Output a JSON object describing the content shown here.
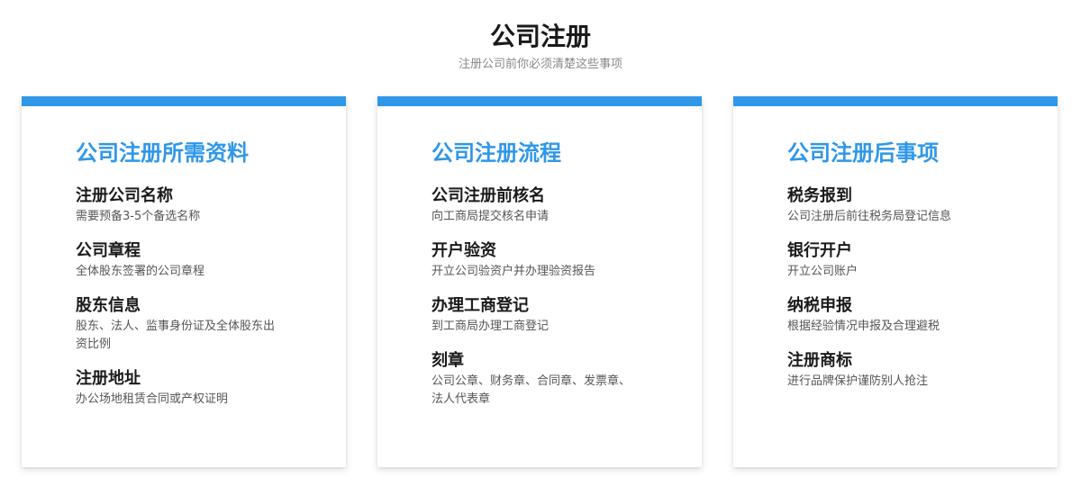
{
  "header": {
    "title": "公司注册",
    "subtitle": "注册公司前你必须清楚这些事项"
  },
  "cards": [
    {
      "title": "公司注册所需资料",
      "items": [
        {
          "title": "注册公司名称",
          "desc": "需要预备3-5个备选名称"
        },
        {
          "title": "公司章程",
          "desc": "全体股东签署的公司章程"
        },
        {
          "title": "股东信息",
          "desc": "股东、法人、监事身份证及全体股东出资比例"
        },
        {
          "title": "注册地址",
          "desc": "办公场地租赁合同或产权证明"
        }
      ]
    },
    {
      "title": "公司注册流程",
      "items": [
        {
          "title": "公司注册前核名",
          "desc": "向工商局提交核名申请"
        },
        {
          "title": "开户验资",
          "desc": "开立公司验资户并办理验资报告"
        },
        {
          "title": "办理工商登记",
          "desc": "到工商局办理工商登记"
        },
        {
          "title": "刻章",
          "desc": "公司公章、财务章、合同章、发票章、法人代表章"
        }
      ]
    },
    {
      "title": "公司注册后事项",
      "items": [
        {
          "title": "税务报到",
          "desc": "公司注册后前往税务局登记信息"
        },
        {
          "title": "银行开户",
          "desc": "开立公司账户"
        },
        {
          "title": "纳税申报",
          "desc": "根据经验情况申报及合理避税"
        },
        {
          "title": "注册商标",
          "desc": "进行品牌保护谨防别人抢注"
        }
      ]
    }
  ],
  "colors": {
    "accent": "#2f97e8",
    "title_text": "#1a1a1a",
    "desc_text": "#555555",
    "subtitle_text": "#888888"
  }
}
